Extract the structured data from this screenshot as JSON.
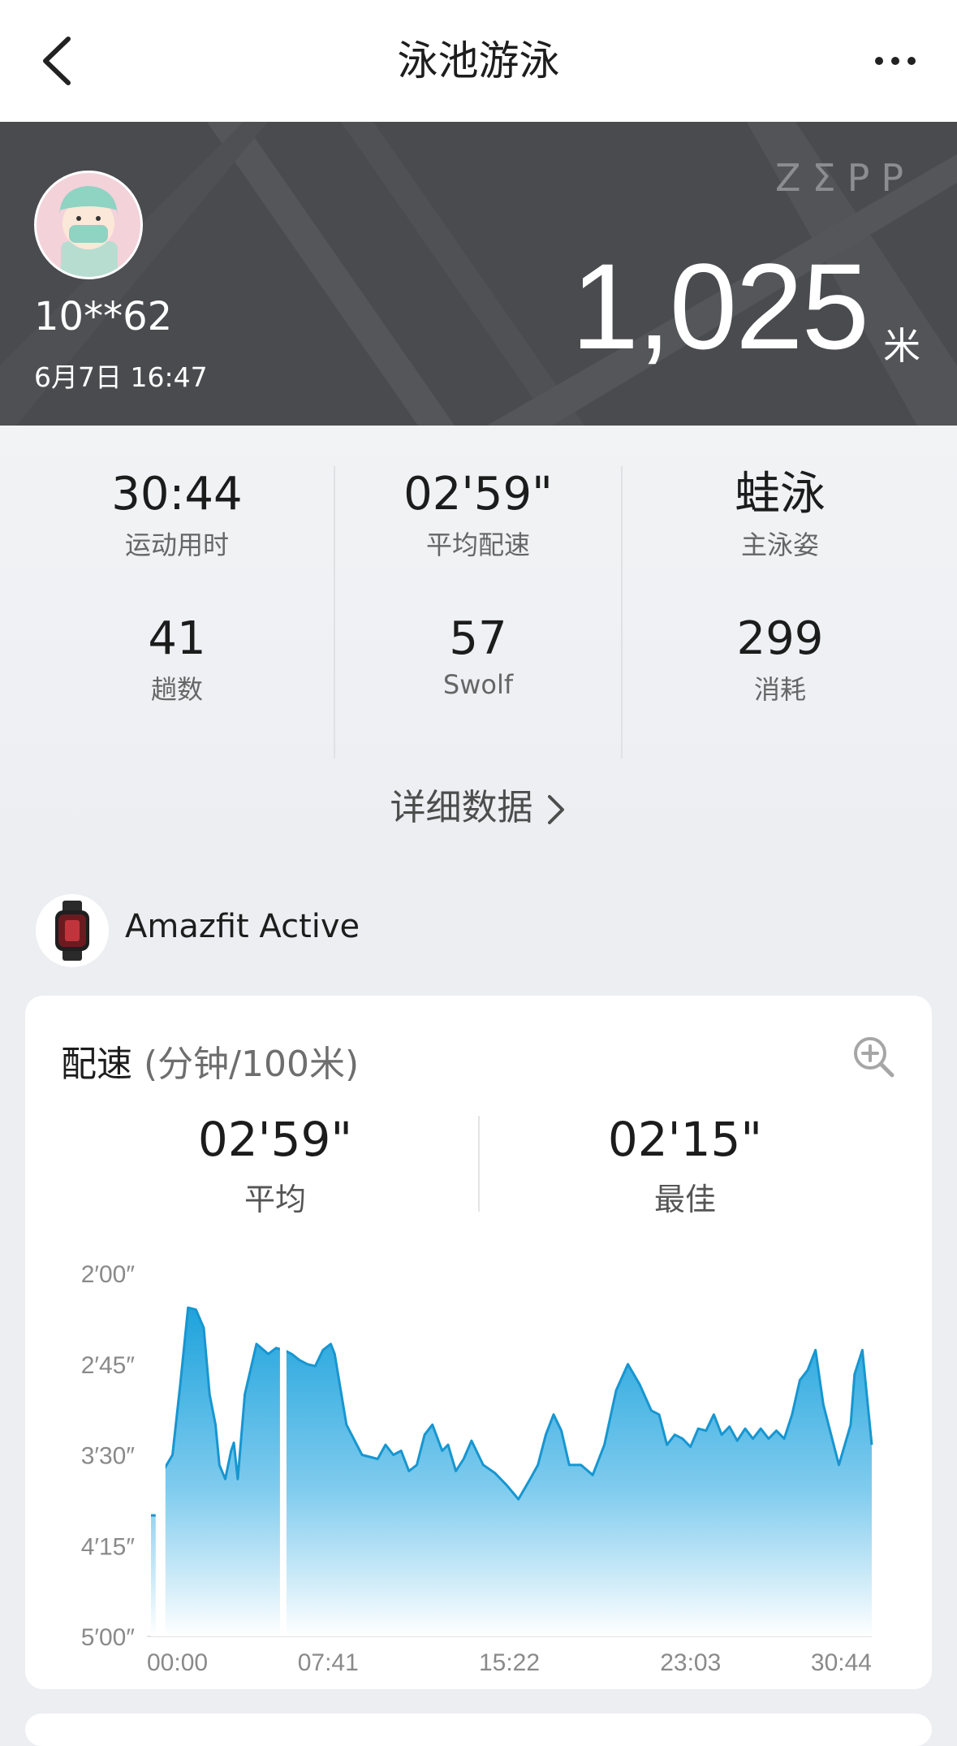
{
  "nav": {
    "title": "泳池游泳"
  },
  "header": {
    "brand": "ZΣPP",
    "user_name": "10**62",
    "datetime": "6月7日 16:47",
    "distance": "1,025",
    "distance_unit": "米"
  },
  "stats": [
    {
      "value": "30:44",
      "label": "运动用时"
    },
    {
      "value": "02'59\"",
      "label": "平均配速"
    },
    {
      "value": "蛙泳",
      "label": "主泳姿"
    },
    {
      "value": "41",
      "label": "趟数"
    },
    {
      "value": "57",
      "label": "Swolf"
    },
    {
      "value": "299",
      "label": "消耗"
    }
  ],
  "detail_link": "详细数据",
  "device": {
    "name": "Amazfit Active"
  },
  "pace_card": {
    "title": "配速",
    "unit": "(分钟/100米)",
    "average": {
      "value": "02'59\"",
      "label": "平均"
    },
    "best": {
      "value": "02'15\"",
      "label": "最佳"
    }
  },
  "colors": {
    "accent": "#1ea3dc",
    "banner": "#4a4b4f"
  },
  "chart_data": {
    "type": "area",
    "y_ticks": [
      "2′00″",
      "2′45″",
      "3′30″",
      "4′15″",
      "5′00″"
    ],
    "x_ticks": [
      "00:00",
      "07:41",
      "15:22",
      "23:03",
      "30:44"
    ],
    "y_axis": "pace (seconds per 100m), inverted: faster at top",
    "ylim": [
      120,
      300
    ],
    "xlim": [
      0,
      1844
    ],
    "grid": false,
    "x": [
      0,
      20,
      25,
      55,
      75,
      95,
      115,
      135,
      150,
      165,
      175,
      190,
      205,
      212,
      222,
      240,
      270,
      300,
      320,
      340,
      360,
      380,
      400,
      420,
      440,
      460,
      470,
      500,
      540,
      580,
      600,
      620,
      640,
      660,
      680,
      700,
      720,
      745,
      760,
      780,
      800,
      820,
      850,
      880,
      910,
      940,
      970,
      990,
      1010,
      1030,
      1050,
      1070,
      1100,
      1130,
      1160,
      1190,
      1220,
      1250,
      1280,
      1300,
      1320,
      1340,
      1360,
      1380,
      1400,
      1420,
      1440,
      1460,
      1480,
      1500,
      1520,
      1540,
      1560,
      1580,
      1600,
      1620,
      1640,
      1660,
      1680,
      1700,
      1720,
      1740,
      1760,
      1790,
      1800,
      1820,
      1844
    ],
    "y": [
      240,
      240,
      220,
      210,
      175,
      137,
      138,
      147,
      180,
      195,
      215,
      222,
      208,
      204,
      222,
      180,
      155,
      160,
      157,
      158,
      160,
      163,
      165,
      166,
      158,
      155,
      160,
      195,
      210,
      212,
      205,
      210,
      208,
      218,
      215,
      200,
      195,
      208,
      205,
      218,
      212,
      203,
      215,
      219,
      225,
      232,
      222,
      215,
      200,
      190,
      198,
      215,
      215,
      220,
      205,
      178,
      165,
      175,
      188,
      190,
      205,
      200,
      202,
      206,
      197,
      198,
      190,
      200,
      196,
      203,
      197,
      202,
      197,
      202,
      198,
      202,
      190,
      173,
      168,
      158,
      185,
      200,
      215,
      195,
      170,
      158,
      205
    ]
  }
}
